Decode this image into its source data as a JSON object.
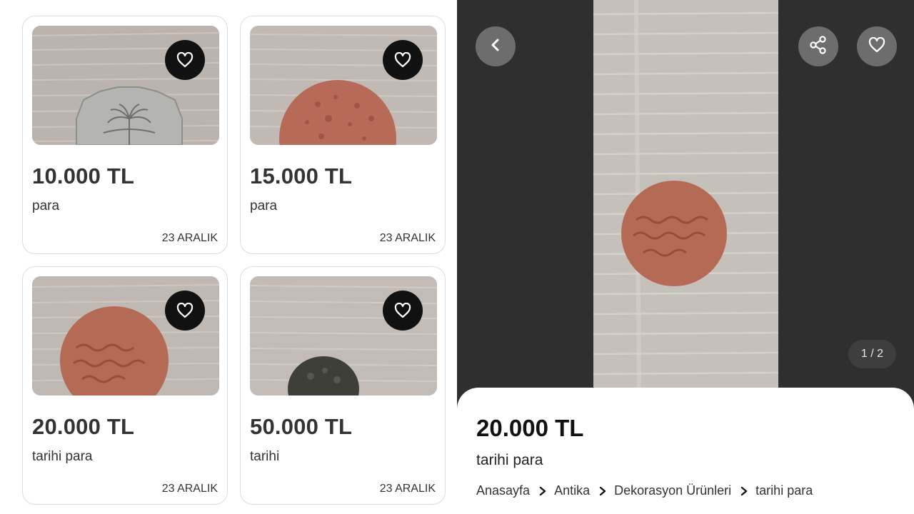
{
  "listings": [
    {
      "price": "10.000 TL",
      "title": "para",
      "date": "23 ARALIK"
    },
    {
      "price": "15.000 TL",
      "title": "para",
      "date": "23 ARALIK"
    },
    {
      "price": "20.000 TL",
      "title": "tarihi para",
      "date": "23 ARALIK"
    },
    {
      "price": "50.000 TL",
      "title": "tarihi",
      "date": "23 ARALIK"
    }
  ],
  "detail": {
    "counter": "1 / 2",
    "price": "20.000 TL",
    "title": "tarihi para",
    "breadcrumbs": [
      "Anasayfa",
      "Antika",
      "Dekorasyon Ürünleri",
      "tarihi para"
    ]
  },
  "icons": {
    "favorite": "heart-outline-icon",
    "back": "chevron-left-icon",
    "share": "share-icon",
    "breadcrumb_separator": "chevron-right-icon"
  },
  "colors": {
    "fabric": "#bdb6b1",
    "copper_coin": "#b56a55",
    "silver_coin": "#b4b4b0",
    "dark_coin": "#3f3f3a",
    "viewer_bg": "#2f2f2f"
  }
}
